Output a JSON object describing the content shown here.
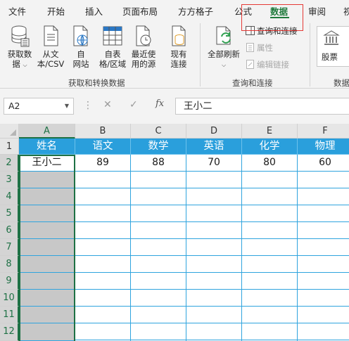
{
  "tabs": [
    "文件",
    "开始",
    "插入",
    "页面布局",
    "方方格子",
    "公式",
    "数据",
    "审阅",
    "视"
  ],
  "active_tab": "数据",
  "ribbon": {
    "get_data": [
      "获取数",
      "据"
    ],
    "from_csv": [
      "从文",
      "本/CSV"
    ],
    "from_web": [
      "自",
      "网站"
    ],
    "from_table": [
      "自表",
      "格/区域"
    ],
    "recent_sources": [
      "最近使",
      "用的源"
    ],
    "existing_conn": [
      "现有",
      "连接"
    ],
    "group_get_transform": "获取和转换数据",
    "refresh_all": "全部刷新",
    "queries_connections": "查询和连接",
    "properties": "属性",
    "edit_links": "编辑链接",
    "group_queries": "查询和连接",
    "stocks": "股票",
    "group_data_types": "数据"
  },
  "formula_bar": {
    "name_box": "A2",
    "cancel": "✕",
    "enter": "✓",
    "fx": "fx",
    "formula": "王小二"
  },
  "columns": [
    "A",
    "B",
    "C",
    "D",
    "E",
    "F"
  ],
  "rows": [
    "1",
    "2",
    "3",
    "4",
    "5",
    "6",
    "7",
    "8",
    "9",
    "10",
    "11",
    "12"
  ],
  "sheet": {
    "headers": [
      "姓名",
      "语文",
      "数学",
      "英语",
      "化学",
      "物理"
    ],
    "row2": [
      "王小二",
      "89",
      "88",
      "70",
      "80",
      "60"
    ]
  },
  "colors": {
    "accent": "#1f7a3c",
    "header_fill": "#2a9fdc",
    "grid_line": "#2fa4de",
    "highlight_box": "#e53935",
    "selection_fill": "#c8c8c8"
  }
}
